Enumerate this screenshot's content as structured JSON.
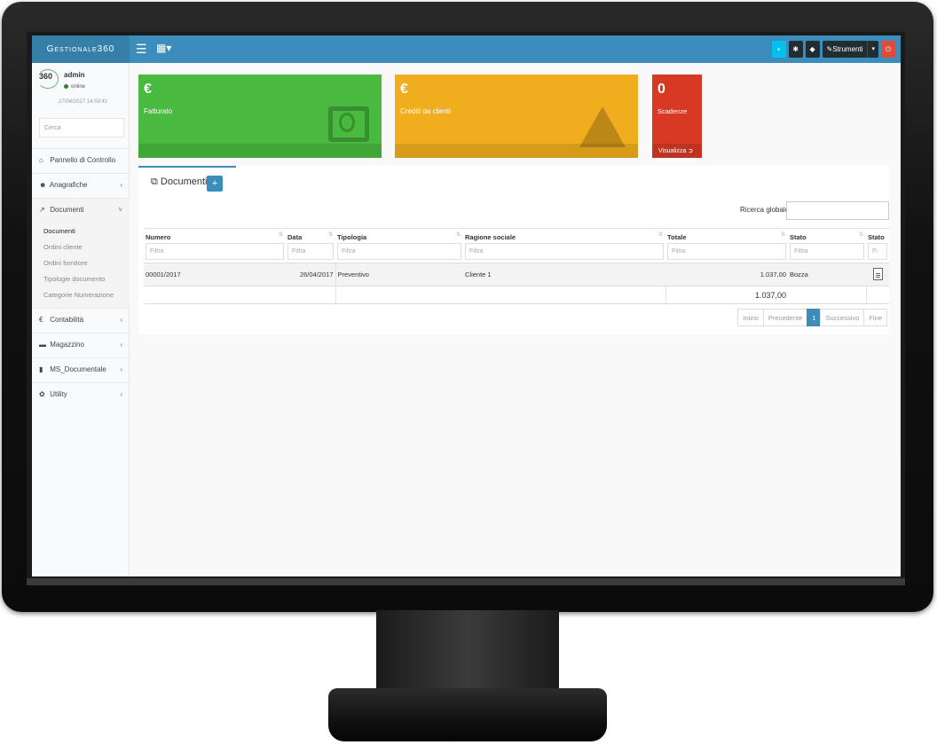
{
  "app": {
    "brand": "Gestionale360"
  },
  "topbar": {
    "menu_icon": "hamburger-icon",
    "calendar_icon": "calendar-icon",
    "right_buttons": [
      {
        "name": "notifications-button",
        "icon": "bell-icon",
        "color": "#00c0ef"
      },
      {
        "name": "tools-icon-button-1",
        "icon": "bug-icon",
        "color": "#222d32"
      },
      {
        "name": "tools-icon-button-2",
        "icon": "tag-icon",
        "color": "#222d32"
      }
    ],
    "strumenti_label": "Strumenti",
    "power_icon": "power-icon"
  },
  "user": {
    "logo": "360",
    "name": "admin",
    "status": "online",
    "date": "27/04/2017 14:59:41"
  },
  "sidebar": {
    "search_placeholder": "Cerca",
    "items": [
      {
        "label": "Pannello di Controllo",
        "icon": "dashboard-icon"
      },
      {
        "label": "Anagrafiche",
        "icon": "users-icon"
      },
      {
        "label": "Documenti",
        "icon": "chart-icon"
      },
      {
        "label": "Contabilità",
        "icon": "euro-icon"
      },
      {
        "label": "Magazzino",
        "icon": "truck-icon"
      },
      {
        "label": "MS_Documentale",
        "icon": "file-icon"
      },
      {
        "label": "Utility",
        "icon": "cog-icon"
      }
    ],
    "documenti_sub": [
      "Documenti",
      "Ordini cliente",
      "Ordini fornitore",
      "Tipologie documento",
      "Categorie Numerazione"
    ]
  },
  "info_boxes": {
    "fatturato": {
      "value": "€",
      "label": "Fatturato",
      "color": "#49b93f"
    },
    "crediti": {
      "value": "€",
      "label": "Crediti da clienti",
      "color": "#f0ad1e"
    },
    "scadenze": {
      "value": "0",
      "label": "Scadenze",
      "footer": "Visualizza",
      "color": "#d73925"
    }
  },
  "documents": {
    "title": "Documenti",
    "add_label": "+",
    "global_search_label": "Ricerca globale:",
    "columns": [
      "Numero",
      "Data",
      "Tipologia",
      "Ragione sociale",
      "Totale",
      "Stato",
      "Stato"
    ],
    "filter_placeholder": "Filtra",
    "filter_placeholder_short": "Fi",
    "rows": [
      {
        "numero": "00001/2017",
        "data": "26/04/2017",
        "tipologia": "Preventivo",
        "ragione_sociale": "Cliente 1",
        "totale": "1.037,00",
        "stato": "Bozza"
      }
    ],
    "total": "1.037,00",
    "pagination": [
      "Inizio",
      "Precedente",
      "1",
      "Successivo",
      "Fine"
    ]
  }
}
